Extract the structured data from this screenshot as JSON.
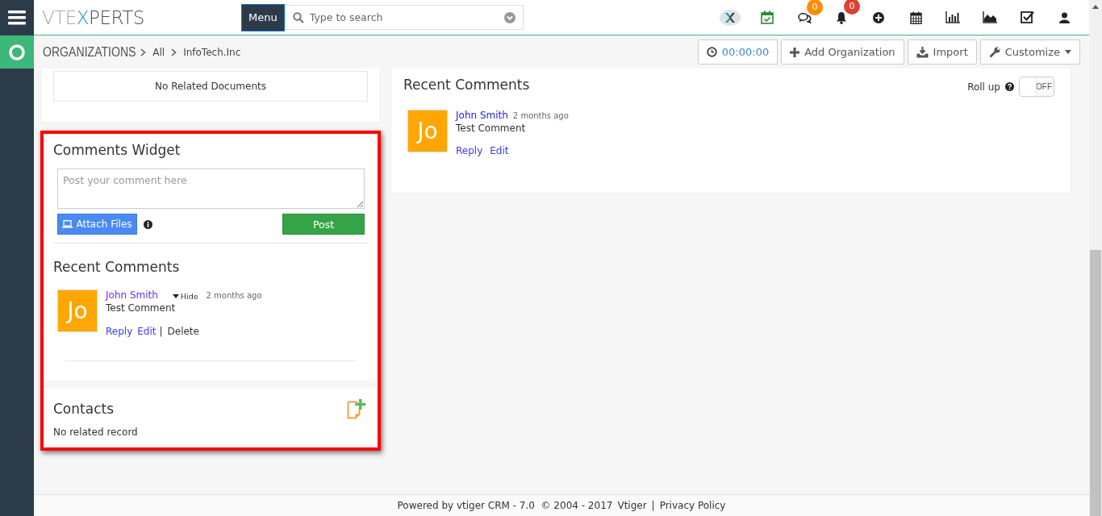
{
  "logo": [
    {
      "text": "VTE",
      "color": "#a4a7aa"
    },
    {
      "text": "X",
      "color": "#1a9ba8"
    },
    {
      "text": "PERTS",
      "color": "#4a4f55"
    }
  ],
  "menu_button": "Menu",
  "search": {
    "placeholder": "Type to search"
  },
  "top_icons": [
    {
      "kind": "brand"
    },
    {
      "kind": "calendar-check"
    },
    {
      "kind": "comments",
      "badge": "0",
      "color": "#ff8c00"
    },
    {
      "kind": "bell",
      "badge": "0",
      "color": "#d9432f"
    },
    {
      "kind": "plus"
    },
    {
      "kind": "calendar"
    },
    {
      "kind": "bar-chart"
    },
    {
      "kind": "area-chart"
    },
    {
      "kind": "checkbox"
    },
    {
      "kind": "user"
    }
  ],
  "breadcrumb": {
    "module": "ORGANIZATIONS",
    "items": [
      "All",
      "InfoTech.Inc"
    ]
  },
  "header_buttons": [
    {
      "kind": "timer",
      "label": "00:00:00"
    },
    {
      "kind": "add",
      "label": "Add Organization"
    },
    {
      "kind": "import",
      "label": "Import"
    },
    {
      "kind": "customize",
      "label": "Customize"
    }
  ],
  "documents": {
    "empty_text": "No Related Documents"
  },
  "comments_widget": {
    "title": "Comments Widget",
    "placeholder": "Post your comment here",
    "attach_label": "Attach Files",
    "post_label": "Post",
    "recent_title": "Recent Comments",
    "comments": [
      {
        "avatar": "Jo",
        "author": "John Smith",
        "toggle": "Hide",
        "time": "2 months ago",
        "text": "Test Comment",
        "actions": [
          {
            "label": "Reply",
            "kind": "link"
          },
          {
            "label": "Edit",
            "kind": "link"
          },
          {
            "label": "Delete",
            "kind": "plain",
            "separator": "|"
          }
        ]
      }
    ]
  },
  "contacts": {
    "title": "Contacts",
    "empty_text": "No related record"
  },
  "recent_comments": {
    "title": "Recent Comments",
    "rollup_label": "Roll up",
    "rollup": {
      "on": false,
      "off_label": "OFF"
    },
    "comments": [
      {
        "avatar": "Jo",
        "author": "John Smith",
        "time": "2 months ago",
        "text": "Test Comment",
        "actions": [
          {
            "label": "Reply",
            "kind": "link"
          },
          {
            "label": "Edit",
            "kind": "link"
          }
        ]
      }
    ]
  },
  "footer": {
    "text": "Powered by vtiger CRM - 7.0  © 2004 - 2017",
    "links": [
      "Vtiger",
      "Privacy Policy"
    ],
    "separator": "|"
  }
}
